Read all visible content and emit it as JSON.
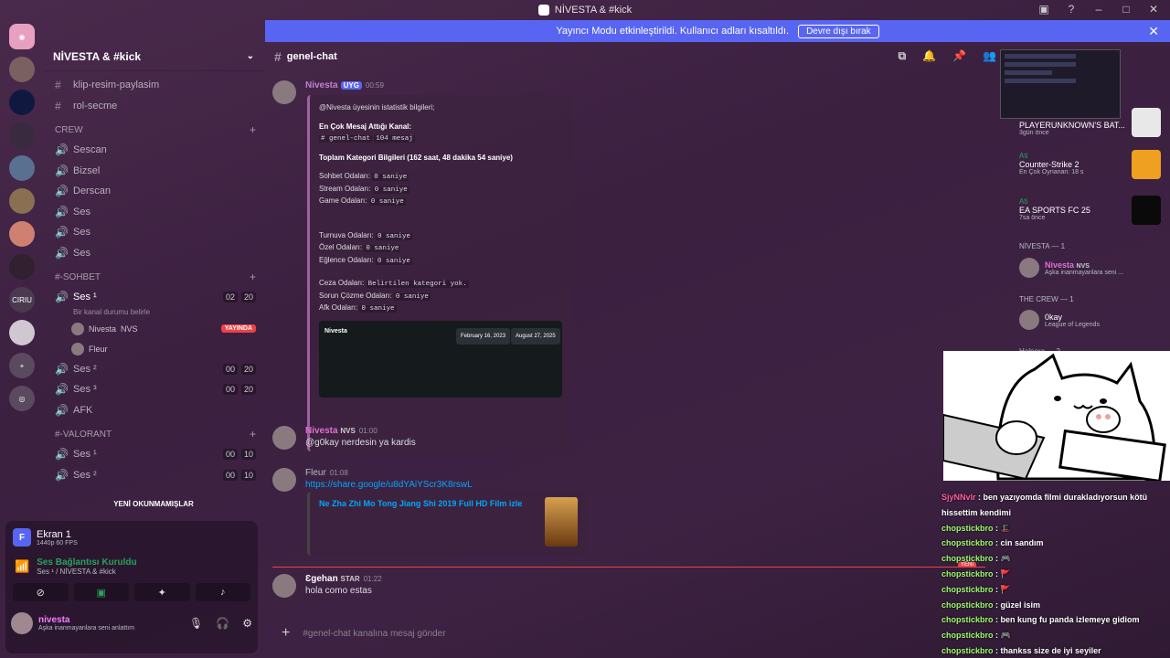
{
  "window": {
    "title": "NİVESTA & #kick"
  },
  "banner": {
    "text": "Yayıncı Modu etkinleştirildi. Kullanıcı adları kısaltıldı.",
    "button": "Devre dışı bırak"
  },
  "server": {
    "name": "NİVESTA & #kick"
  },
  "channels_top": [
    "klip-resim-paylasim",
    "rol-secme"
  ],
  "cat_crew": "CREW",
  "crew": [
    "Sescan",
    "Bizsel",
    "Derscan",
    "Ses",
    "Ses",
    "Ses"
  ],
  "cat_sohbet": "#-SOHBET",
  "sohbet": {
    "ses1": "Ses ¹",
    "ses1_a": "02",
    "ses1_b": "20",
    "status": "Bir kanal durumu belirle",
    "user1": "Nivesta",
    "user1_tag": "NVS",
    "live": "YAYINDA",
    "user2": "Fleur",
    "ses2": "Ses ²",
    "ses2_a": "00",
    "ses2_b": "20",
    "ses3": "Ses ³",
    "ses3_a": "00",
    "ses3_b": "20",
    "afk": "AFK"
  },
  "cat_valorant": "#-VALORANT",
  "valorant": {
    "ses1": "Ses ¹",
    "a1": "00",
    "b1": "10",
    "ses2": "Ses ²",
    "a2": "00",
    "b2": "10"
  },
  "unread": "YENİ OKUNMAMIŞLAR",
  "screen": {
    "title": "Ekran 1",
    "sub": "1440p 60 FPS"
  },
  "voice": {
    "title": "Ses Bağlantısı Kuruldu",
    "sub": "Ses ¹ / NİVESTA & #kick"
  },
  "me": {
    "name": "nivesta",
    "status": "Aşka inanmayanlara seni anlattım"
  },
  "chat": {
    "channel": "genel-chat",
    "m1": {
      "name": "Nivesta",
      "tag": "UYG",
      "time": "00:59"
    },
    "embed": {
      "intro": "@Nivesta üyesinin istatistik bilgileri;",
      "h1": "En Çok Mesaj Attığı Kanal:",
      "ch": "# genel-chat",
      "cnt": "104 mesaj",
      "h2": "Toplam Kategori Bilgileri (162 saat, 48 dakika 54 saniye)",
      "rows": [
        "Sohbet Odaları:",
        "Stream Odaları:",
        "Game Odaları:"
      ],
      "v": "0 saniye",
      "rows2": [
        "Turnuva Odaları:",
        "Özel Odaları:",
        "Eğlence Odaları:"
      ],
      "ceza": "Ceza Odaları:",
      "ceza_v": "Belirtilen kategori yok.",
      "sorun": "Sorun Çözme Odaları:",
      "afk": "Afk Odaları:",
      "card_name": "Nivesta",
      "card_d1": "February 16, 2023",
      "card_d2": "August 27, 2025"
    },
    "m2": {
      "name": "Nivesta",
      "tag": "NVS",
      "time": "01:00",
      "text": "@g0kay nerdesin ya kardis"
    },
    "m3": {
      "name": "Fleur",
      "time": "01:08",
      "link": "https://share.google/u8dYAiYScr3K8rswL",
      "link_title": "Ne Zha Zhi Mo Tong Jiang Shi 2019 Full HD Film izle"
    },
    "m4": {
      "name": "Ɛgehan",
      "tag": "STAR",
      "time": "01:22",
      "text": "hola como estas"
    },
    "new_tag": "YENİ",
    "input": "#genel-chat kanalına mesaj gönder"
  },
  "activity": [
    {
      "title": "PLAYERUNKNOWN'S BAT...",
      "sub": "3gün önce"
    },
    {
      "name": "Ati",
      "title": "Counter-Strike 2",
      "sub": "En Çok Oynanan: 18 s"
    },
    {
      "name": "Ati",
      "title": "EA SPORTS FC 25",
      "sub": "7sa önce"
    }
  ],
  "members": {
    "cat1": "NİVESTA — 1",
    "m1": "Nivesta",
    "m1_tag": "NVS",
    "m1_st": "Aşka inanmayanlara seni ...",
    "cat2": "THE CREW — 1",
    "m2": "0kay",
    "m2_st": "League of Legends",
    "cat3": "Helpera — 2"
  },
  "chatlog": [
    {
      "u": "SjyNNvlr",
      "t": "ben yazıyomda filmi durakladıyorsun kötü hissettim kendimi",
      "c": "u2"
    },
    {
      "u": "chopstickbro",
      "t": "🎩",
      "c": "u"
    },
    {
      "u": "chopstickbro",
      "t": "cin sandım",
      "c": "u"
    },
    {
      "u": "chopstickbro",
      "t": "🎮",
      "c": "u"
    },
    {
      "u": "chopstickbro",
      "t": "🚩",
      "c": "u"
    },
    {
      "u": "chopstickbro",
      "t": "🚩",
      "c": "u"
    },
    {
      "u": "chopstickbro",
      "t": "güzel isim",
      "c": "u"
    },
    {
      "u": "chopstickbro",
      "t": "ben kung fu panda izlemeye gidiom",
      "c": "u"
    },
    {
      "u": "chopstickbro",
      "t": "🎮",
      "c": "u"
    },
    {
      "u": "chopstickbro",
      "t": "thankss size de iyi seyiler",
      "c": "u"
    }
  ]
}
